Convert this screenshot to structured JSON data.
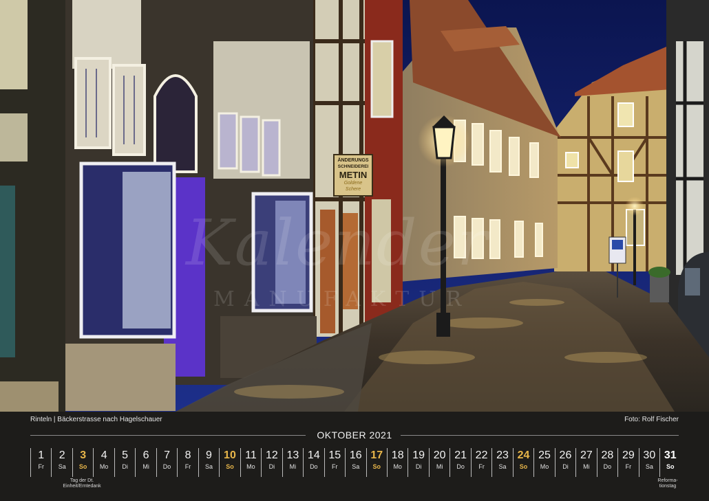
{
  "caption": {
    "place": "Rinteln | Bäckerstrasse nach Hagelschauer",
    "credit": "Foto: Rolf Fischer"
  },
  "shop_sign": {
    "line1": "ÄNDERUNGS",
    "line2": "SCHNEIDEREI",
    "line3": "METIN",
    "line4": "Goldene",
    "line5": "Schere"
  },
  "watermark": {
    "script": "Kalender",
    "sub": "MANUFAKTUR"
  },
  "calendar": {
    "month_title": "OKTOBER 2021",
    "days": [
      {
        "n": "1",
        "wd": "Fr"
      },
      {
        "n": "2",
        "wd": "Sa"
      },
      {
        "n": "3",
        "wd": "So"
      },
      {
        "n": "4",
        "wd": "Mo"
      },
      {
        "n": "5",
        "wd": "Di"
      },
      {
        "n": "6",
        "wd": "Mi"
      },
      {
        "n": "7",
        "wd": "Do"
      },
      {
        "n": "8",
        "wd": "Fr"
      },
      {
        "n": "9",
        "wd": "Sa"
      },
      {
        "n": "10",
        "wd": "So"
      },
      {
        "n": "11",
        "wd": "Mo"
      },
      {
        "n": "12",
        "wd": "Di"
      },
      {
        "n": "13",
        "wd": "Mi"
      },
      {
        "n": "14",
        "wd": "Do"
      },
      {
        "n": "15",
        "wd": "Fr"
      },
      {
        "n": "16",
        "wd": "Sa"
      },
      {
        "n": "17",
        "wd": "So"
      },
      {
        "n": "18",
        "wd": "Mo"
      },
      {
        "n": "19",
        "wd": "Di"
      },
      {
        "n": "20",
        "wd": "Mi"
      },
      {
        "n": "21",
        "wd": "Do"
      },
      {
        "n": "22",
        "wd": "Fr"
      },
      {
        "n": "23",
        "wd": "Sa"
      },
      {
        "n": "24",
        "wd": "So"
      },
      {
        "n": "25",
        "wd": "Mo"
      },
      {
        "n": "26",
        "wd": "Di"
      },
      {
        "n": "27",
        "wd": "Mi"
      },
      {
        "n": "28",
        "wd": "Do"
      },
      {
        "n": "29",
        "wd": "Fr"
      },
      {
        "n": "30",
        "wd": "Sa"
      },
      {
        "n": "31",
        "wd": "So"
      }
    ],
    "notes": {
      "day3": "Tag der Dt. Einheit/Erntedank",
      "day31": "Reforma-tionstag"
    }
  },
  "colors": {
    "sunday": "#e8b64a",
    "strip_bg": "#1d1c1a"
  }
}
